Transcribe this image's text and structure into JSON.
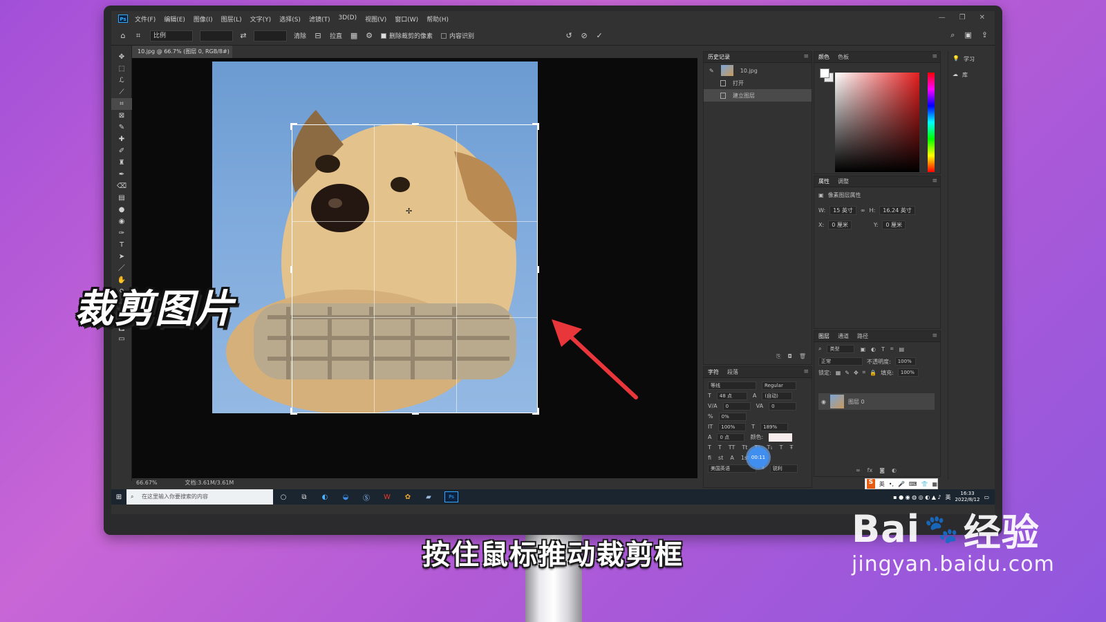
{
  "overlay": {
    "title": "裁剪图片",
    "subtitle": "按住鼠标推动裁剪框",
    "watermark_brand": "Bai",
    "watermark_brand_cn": "经验",
    "watermark_url": "jingyan.baidu.com"
  },
  "ps": {
    "logo": "Ps",
    "menu": [
      "文件(F)",
      "编辑(E)",
      "图像(I)",
      "图层(L)",
      "文字(Y)",
      "选择(S)",
      "滤镜(T)",
      "3D(D)",
      "视图(V)",
      "窗口(W)",
      "帮助(H)"
    ],
    "window_controls": [
      "—",
      "❐",
      "✕"
    ],
    "options": {
      "ratio": "比例",
      "clear_label": "清除",
      "straighten_label": "拉直",
      "delete_cropped_label": "删除裁剪的像素",
      "content_aware_label": "内容识别"
    },
    "doc_tab": "10.jpg @ 66.7% (图层 0, RGB/8#) *",
    "status": {
      "zoom": "66.67%",
      "doc_size": "文档:3.61M/3.61M"
    },
    "history": {
      "tabs": [
        "历史记录"
      ],
      "snapshot": "10.jpg",
      "items": [
        "打开",
        "建立图层"
      ]
    },
    "color_panel": {
      "tabs": [
        "颜色",
        "色板"
      ],
      "hue_color": "#e41e1e"
    },
    "properties": {
      "tabs": [
        "属性",
        "调整"
      ],
      "section": "像素图层属性",
      "w_label": "W:",
      "w_value": "15 英寸",
      "h_label": "H:",
      "h_value": "16.24 英寸",
      "x_label": "X:",
      "x_value": "0 厘米",
      "y_label": "Y:",
      "y_value": "0 厘米"
    },
    "character": {
      "tabs": [
        "字符",
        "段落"
      ],
      "font": "等线",
      "style": "Regular",
      "size": "48 点",
      "leading": "(自动)",
      "kerning": "0",
      "tracking": "0",
      "scale_pct": "0%",
      "vscale": "100%",
      "hscale": "189%",
      "baseline": "0 点",
      "color_label": "颜色:",
      "language": "美国英语",
      "aa": "锐利",
      "timer": "00:11"
    },
    "layers": {
      "tabs": [
        "图层",
        "通道",
        "路径"
      ],
      "filter": "类型",
      "blend": "正常",
      "opacity_label": "不透明度:",
      "opacity": "100%",
      "lock_label": "锁定:",
      "fill_label": "填充:",
      "fill": "100%",
      "layer_name": "图层 0"
    },
    "right_strip": [
      "学习",
      "库"
    ]
  },
  "taskbar": {
    "search_placeholder": "在这里输入你要搜索的内容",
    "time": "16:33",
    "date": "2022/8/12",
    "lang": "英",
    "ime_label": "英"
  }
}
